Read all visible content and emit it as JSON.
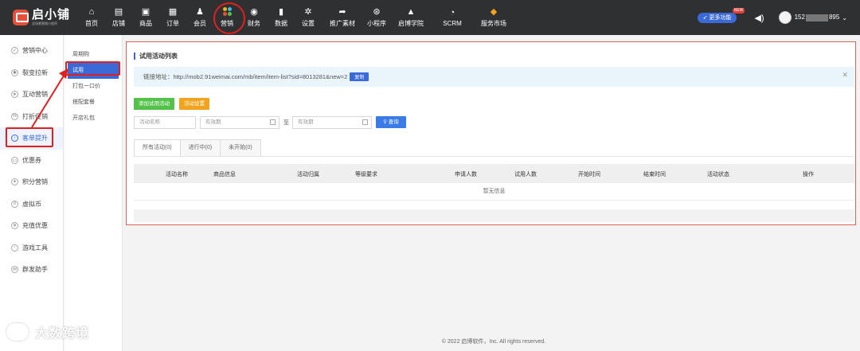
{
  "brand": {
    "title": "启小铺",
    "subtitle": "全场景营销小程序"
  },
  "nav": [
    {
      "label": "首页",
      "icon": "home-icon",
      "glyph": "⌂"
    },
    {
      "label": "店铺",
      "icon": "store-icon",
      "glyph": "▤"
    },
    {
      "label": "商品",
      "icon": "goods-icon",
      "glyph": "▣"
    },
    {
      "label": "订单",
      "icon": "order-icon",
      "glyph": "▦"
    },
    {
      "label": "会员",
      "icon": "member-icon",
      "glyph": "♟"
    },
    {
      "label": "营销",
      "icon": "marketing-icon",
      "glyph": ""
    },
    {
      "label": "财务",
      "icon": "finance-icon",
      "glyph": "◉"
    },
    {
      "label": "数据",
      "icon": "data-icon",
      "glyph": "▮"
    },
    {
      "label": "设置",
      "icon": "settings-icon",
      "glyph": "✲"
    },
    {
      "label": "推广素材",
      "icon": "share-icon",
      "glyph": "➦"
    },
    {
      "label": "小程序",
      "icon": "miniprogram-icon",
      "glyph": "⊛"
    },
    {
      "label": "启博学院",
      "icon": "academy-icon",
      "glyph": "▲"
    },
    {
      "label": "SCRM",
      "icon": "scrm-icon",
      "glyph": "◔"
    },
    {
      "label": "服务市场",
      "icon": "diamond-icon",
      "glyph": "◆"
    }
  ],
  "top_right": {
    "more_label": "更多功能",
    "new_badge": "NEW",
    "phone_prefix": "152",
    "phone_suffix": "895"
  },
  "sidebar": [
    {
      "label": "营销中心",
      "glyph": "✓"
    },
    {
      "label": "裂变拉新",
      "glyph": "✱"
    },
    {
      "label": "互动营销",
      "glyph": "➤"
    },
    {
      "label": "打折促销",
      "glyph": "%"
    },
    {
      "label": "客单提升",
      "glyph": "↑"
    },
    {
      "label": "优惠券",
      "glyph": "▭"
    },
    {
      "label": "积分营销",
      "glyph": "✦"
    },
    {
      "label": "虚拟币",
      "glyph": "¤"
    },
    {
      "label": "充值优惠",
      "glyph": "¥"
    },
    {
      "label": "游戏工具",
      "glyph": "▫"
    },
    {
      "label": "群发助手",
      "glyph": "✉"
    }
  ],
  "subnav": [
    {
      "label": "周期购"
    },
    {
      "label": "试用"
    },
    {
      "label": "打包一口价"
    },
    {
      "label": "搭配套餐"
    },
    {
      "label": "开店礼包"
    }
  ],
  "panel": {
    "title": "试用活动列表",
    "link_label": "链接地址：",
    "link_url": "http://mob2.91weimai.com/mb/item/item-list?sid=8013281&new=2",
    "copy_label": "复制",
    "add_button": "添加试用活动",
    "settings_button": "活动设置",
    "name_placeholder": "活动名称",
    "start_placeholder": "有效期",
    "to_label": "至",
    "end_placeholder": "有效期",
    "search_label": "查询",
    "tabs": [
      "所有活动(0)",
      "进行中(0)",
      "未开始(0)"
    ],
    "columns": [
      "活动名称",
      "商品信息",
      "活动归属",
      "等级要求",
      "申请人数",
      "试用人数",
      "开始时间",
      "结束时间",
      "活动状态",
      "操作"
    ],
    "empty_text": "暂无信息"
  },
  "footer": "© 2022 启博软件，Inc. All rights reserved.",
  "watermark": "大数跨境",
  "colors": {
    "accent": "#3b6ad8",
    "green": "#54c24a",
    "orange": "#f2a41d",
    "annotation_red": "#e02020"
  }
}
